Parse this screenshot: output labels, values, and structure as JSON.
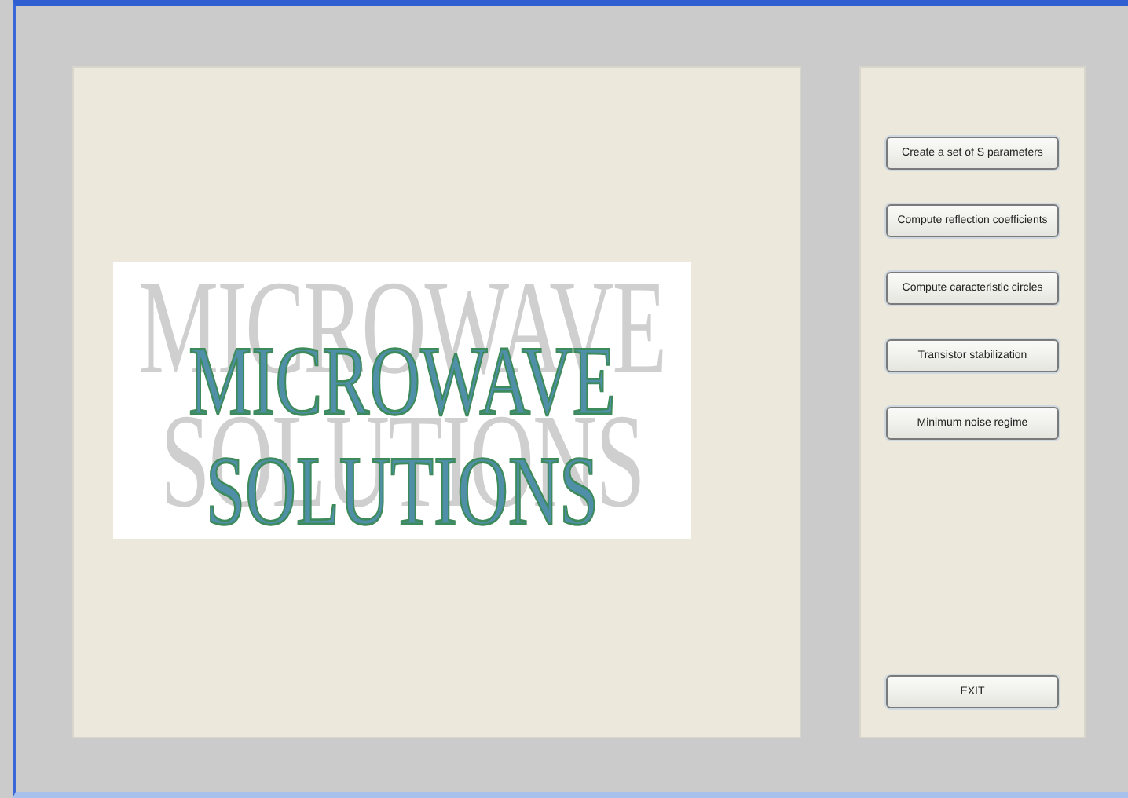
{
  "logo": {
    "shadow_lines": [
      "MICROWAVE",
      "SOLUTIONS"
    ],
    "lines": [
      "MICROWAVE",
      "SOLUTIONS"
    ]
  },
  "buttons": [
    {
      "label": "Create a set of S parameters"
    },
    {
      "label": "Compute reflection coefficients"
    },
    {
      "label": "Compute caracteristic circles"
    },
    {
      "label": "Transistor stabilization"
    },
    {
      "label": "Minimum noise regime"
    }
  ],
  "exit_button": {
    "label": "EXIT"
  }
}
